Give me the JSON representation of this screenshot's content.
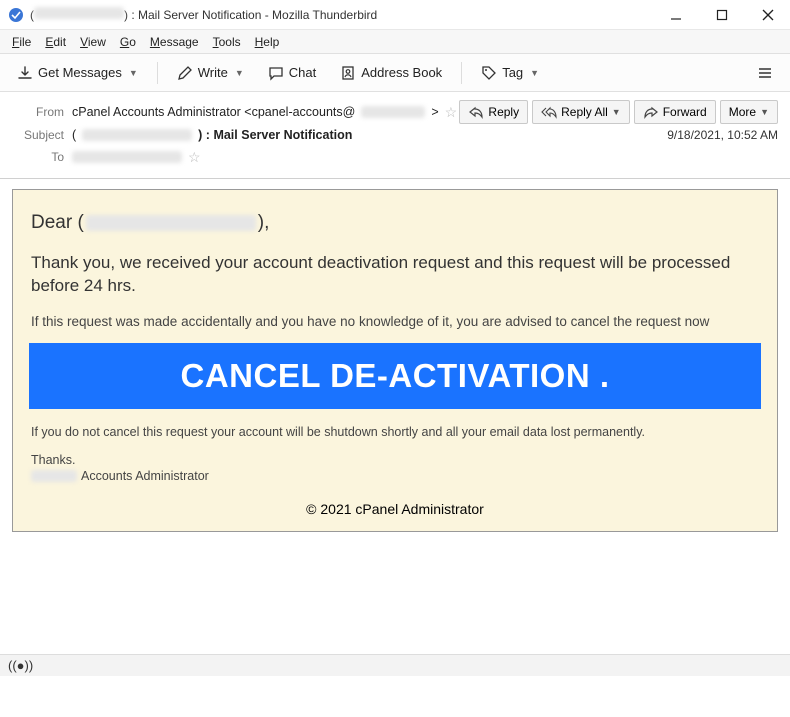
{
  "window": {
    "title_prefix": "(",
    "title_redacted": "████████",
    "title_suffix": ") : Mail Server Notification - Mozilla Thunderbird"
  },
  "menubar": {
    "file": "File",
    "edit": "Edit",
    "view": "View",
    "go": "Go",
    "message": "Message",
    "tools": "Tools",
    "help": "Help"
  },
  "toolbar": {
    "get_messages": "Get Messages",
    "write": "Write",
    "chat": "Chat",
    "address_book": "Address Book",
    "tag": "Tag"
  },
  "header": {
    "from_label": "From",
    "from_value_prefix": "cPanel Accounts Administrator <cpanel-accounts@",
    "from_value_suffix": ">",
    "subject_label": "Subject",
    "subject_prefix": "(",
    "subject_suffix": ") : Mail Server Notification",
    "to_label": "To",
    "date": "9/18/2021, 10:52 AM",
    "reply": "Reply",
    "reply_all": "Reply All",
    "forward": "Forward",
    "more": "More"
  },
  "email": {
    "greeting_prefix": "Dear (",
    "greeting_suffix": "),",
    "p1": "Thank you, we received your account deactivation request and this request will be processed before 24 hrs.",
    "p2": "If this request was made accidentally and you have no knowledge of it, you are advised to cancel the request now",
    "button": "CANCEL DE-ACTIVATION .",
    "p3": "If you do not cancel this request your account will be shutdown shortly and all your email data lost permanently.",
    "p4": "Thanks.",
    "p5_suffix": " Accounts Administrator",
    "footer": "© 2021 cPanel Administrator"
  }
}
